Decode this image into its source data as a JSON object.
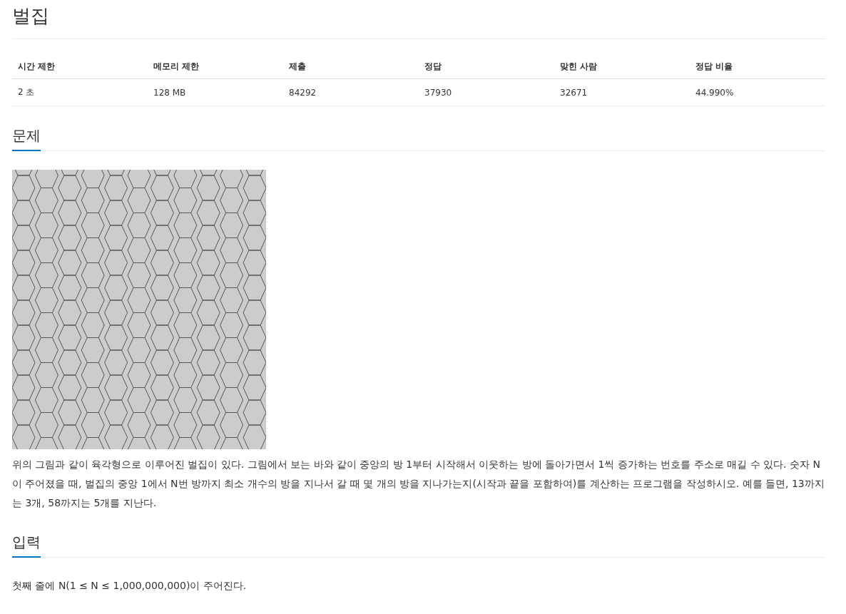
{
  "title": "벌집",
  "stats": {
    "columns": [
      "시간 제한",
      "메모리 제한",
      "제출",
      "정답",
      "맞힌 사람",
      "정답 비율"
    ],
    "values": [
      "2 초",
      "128 MB",
      "84292",
      "37930",
      "32671",
      "44.990%"
    ]
  },
  "sections": [
    {
      "heading": "문제",
      "kind": "figure_text",
      "text": "위의 그림과 같이 육각형으로 이루어진 벌집이 있다. 그림에서 보는 바와 같이 중앙의 방 1부터 시작해서 이웃하는 방에 돌아가면서 1씩 증가하는 번호를 주소로 매길 수 있다. 숫자 N이 주어졌을 때, 벌집의 중앙 1에서 N번 방까지 최소 개수의 방을 지나서 갈 때 몇 개의 방을 지나가는지(시작과 끝을 포함하여)를 계산하는 프로그램을 작성하시오. 예를 들면, 13까지는 3개, 58까지는 5개를 지난다."
    },
    {
      "heading": "입력",
      "kind": "text",
      "text": "첫째 줄에 N(1 ≤ N ≤ 1,000,000,000)이 주어진다."
    }
  ]
}
